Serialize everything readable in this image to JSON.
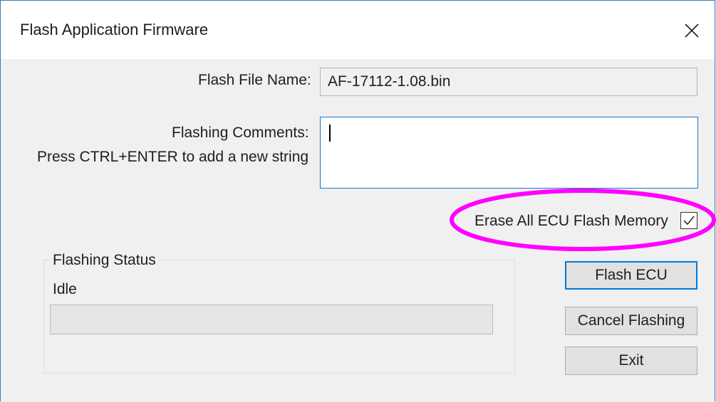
{
  "window": {
    "title": "Flash Application Firmware",
    "close_glyph": "✕"
  },
  "form": {
    "file_name_label": "Flash File Name:",
    "file_name_value": "AF-17112-1.08.bin",
    "comments_label": "Flashing Comments:",
    "comments_hint": "Press CTRL+ENTER to add a new string",
    "comments_value": "",
    "erase_label": "Erase All ECU Flash Memory",
    "erase_checked": true
  },
  "status": {
    "group_title": "Flashing Status",
    "text": "Idle",
    "progress_percent": 0
  },
  "buttons": {
    "flash": "Flash ECU",
    "cancel": "Cancel Flashing",
    "exit": "Exit"
  },
  "colors": {
    "window_border": "#3c7fb1",
    "accent_blue": "#0078d7",
    "highlight_magenta": "#ff00ff",
    "progress_green": "#06b025"
  },
  "icons": {
    "close": "close-icon",
    "check": "checkmark-icon"
  }
}
